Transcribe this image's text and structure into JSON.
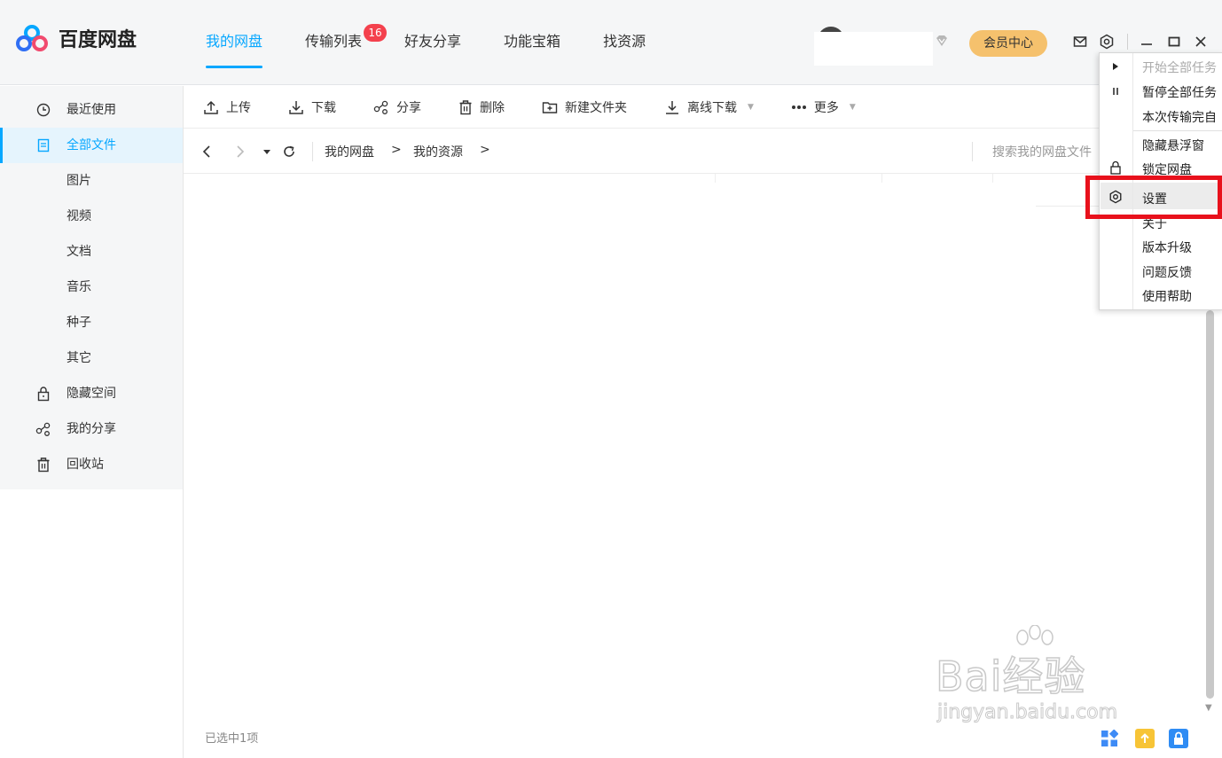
{
  "app": {
    "name": "百度网盘"
  },
  "nav": {
    "tabs": [
      {
        "label": "我的网盘",
        "active": true
      },
      {
        "label": "传输列表",
        "badge": "16"
      },
      {
        "label": "好友分享"
      },
      {
        "label": "功能宝箱"
      },
      {
        "label": "找资源"
      }
    ]
  },
  "header": {
    "vip_label": "会员中心",
    "icons": [
      "mail-icon",
      "gear-icon",
      "minimize-icon",
      "maximize-icon",
      "close-icon"
    ]
  },
  "sidebar": {
    "items": [
      {
        "label": "最近使用",
        "icon": "clock-icon"
      },
      {
        "label": "全部文件",
        "icon": "document-icon",
        "active": true
      },
      {
        "label": "图片"
      },
      {
        "label": "视频"
      },
      {
        "label": "文档"
      },
      {
        "label": "音乐"
      },
      {
        "label": "种子"
      },
      {
        "label": "其它"
      },
      {
        "label": "隐藏空间",
        "icon": "lock-icon"
      },
      {
        "label": "我的分享",
        "icon": "share-icon"
      },
      {
        "label": "回收站",
        "icon": "trash-icon"
      }
    ]
  },
  "toolbar": {
    "upload": "上传",
    "download": "下载",
    "share": "分享",
    "delete": "删除",
    "new_folder": "新建文件夹",
    "offline_download": "离线下载",
    "more": "更多"
  },
  "pathbar": {
    "crumbs": [
      "我的网盘",
      "我的资源"
    ],
    "separator": ">",
    "search_placeholder": "搜索我的网盘文件"
  },
  "menu": {
    "items": [
      {
        "label": "开始全部任务",
        "disabled": true,
        "icon": "play-icon"
      },
      {
        "label": "暂停全部任务",
        "icon": "pause-icon"
      },
      {
        "label": "本次传输完自"
      },
      {
        "label": "隐藏悬浮窗"
      },
      {
        "label": "锁定网盘",
        "icon": "lock-icon"
      },
      {
        "label": "设置",
        "icon": "gear-icon",
        "highlighted": true
      },
      {
        "label": "关于"
      },
      {
        "label": "版本升级"
      },
      {
        "label": "问题反馈"
      },
      {
        "label": "使用帮助"
      }
    ]
  },
  "status": {
    "selection": "已选中1项"
  },
  "watermark": {
    "main": "Bai经验",
    "sub": "jingyan.baidu.com"
  },
  "colors": {
    "accent": "#06a7ff",
    "badge": "#f4414d",
    "vip": "#f5c16d",
    "highlight_box": "#e8111c"
  }
}
